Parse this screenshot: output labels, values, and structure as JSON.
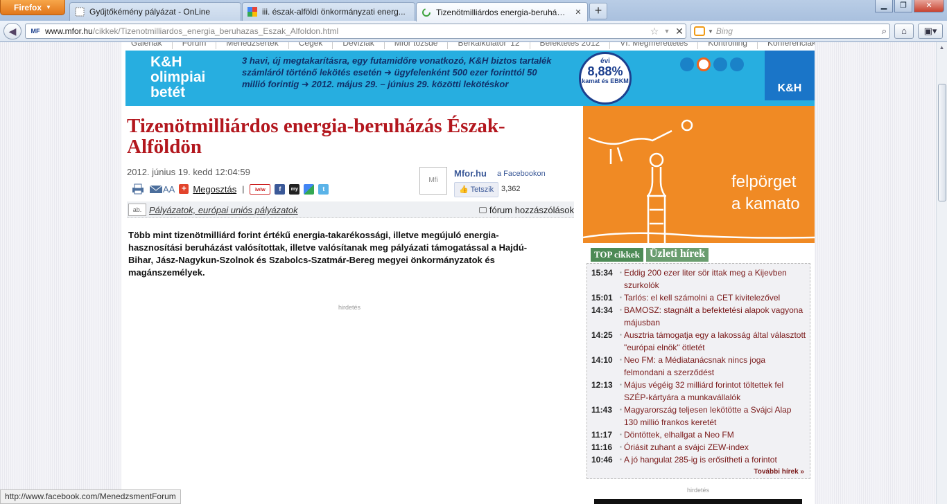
{
  "browser": {
    "app_button": "Firefox",
    "tabs": [
      {
        "title": "Gyűjtőkémény pályázat - OnLine"
      },
      {
        "title": "iii. észak-alföldi önkormányzati energ..."
      },
      {
        "title": "Tizenötmilliárdos energia-beruházás ..."
      }
    ],
    "url_host": "www.mfor.hu",
    "url_path": "/cikkek/Tizenotmilliardos_energia_beruhazas_Eszak_Alfoldon.html",
    "site_badge": "MF",
    "search_placeholder": "Bing",
    "status_url": "http://www.facebook.com/MenedzsmentForum"
  },
  "topnav": [
    "Galériák",
    "Fórum",
    "Menedzsertek",
    "Cégek",
    "Deviziák",
    "Mfor tőzsde",
    "Bérkalkulátor '12",
    "Befektetés 2012",
    "VI. Megmérettetés",
    "Kontrolling",
    "Konferenciák"
  ],
  "banner": {
    "title_lines": [
      "K&H",
      "olimpiai",
      "betét"
    ],
    "text": "3 havi, új megtakarításra, egy futamidőre vonatkozó, K&H biztos tartalék számláról történő lekötés esetén ➜ ügyfelenként 500 ezer forinttól 50 millió forintig ➜ 2012. május 29. – június 29. közötti lekötéskor",
    "rate_prefix": "évi",
    "rate_value": "8,88%",
    "rate_note": "kamat és EBKM",
    "logo": "K&H"
  },
  "side_ad": {
    "text_line1": "felpörget",
    "text_line2": "a kamato"
  },
  "article": {
    "headline": "Tizenötmilliárdos energia-beruházás Észak-Alföldön",
    "date": "2012. június 19. kedd 12:04:59",
    "share_label": "Megosztás",
    "font_size_label": "AA",
    "category": "Pályázatok, európai uniós pályázatok",
    "category_badge": "ab.",
    "forum_label": "fórum hozzászólások",
    "lead": "Több mint tizenötmilliárd forint értékű energia-takarékossági, illetve megújuló energia-hasznosítási beruházást valósítottak, illetve valósítanak meg pályázati támogatással a Hajdú-Bihar, Jász-Nagykun-Szolnok és Szabolcs-Szatmár-Bereg megyei önkormányzatok és magánszemélyek.",
    "ad_label": "hirdetés"
  },
  "facebook": {
    "logo": "Mfi",
    "name": "Mfor.hu",
    "suffix": "a Facebookon",
    "like_label": "Tetszik",
    "like_count": "3,362"
  },
  "sidebar": {
    "tab_top": "TOP cikkek",
    "tab_business": "Üzleti hírek",
    "news": [
      {
        "time": "15:34",
        "title": "Eddig 200 ezer liter sör ittak meg a Kijevben szurkolók"
      },
      {
        "time": "15:01",
        "title": "Tarlós: el kell számolni a CET kivitelezővel"
      },
      {
        "time": "14:34",
        "title": "BAMOSZ: stagnált a befektetési alapok vagyona májusban"
      },
      {
        "time": "14:25",
        "title": "Ausztria támogatja egy a lakosság által választott \"európai elnök\" ötletét"
      },
      {
        "time": "14:10",
        "title": "Neo FM: a Médiatanácsnak nincs joga felmondani a szerződést"
      },
      {
        "time": "12:13",
        "title": "Május végéig 32 milliárd forintot töltettek fel SZÉP-kártyára a munkavállalók"
      },
      {
        "time": "11:43",
        "title": "Magyarország teljesen lekötötte a Svájci Alap 130 millió frankos keretét"
      },
      {
        "time": "11:17",
        "title": "Döntöttek, elhallgat a Neo FM"
      },
      {
        "time": "11:16",
        "title": "Óriásit zuhant a svájci ZEW-index"
      },
      {
        "time": "10:46",
        "title": "A jó hangulat 285-ig is erősítheti a forintot"
      }
    ],
    "more_label": "További hírek »",
    "ad_label": "hirdetés"
  }
}
